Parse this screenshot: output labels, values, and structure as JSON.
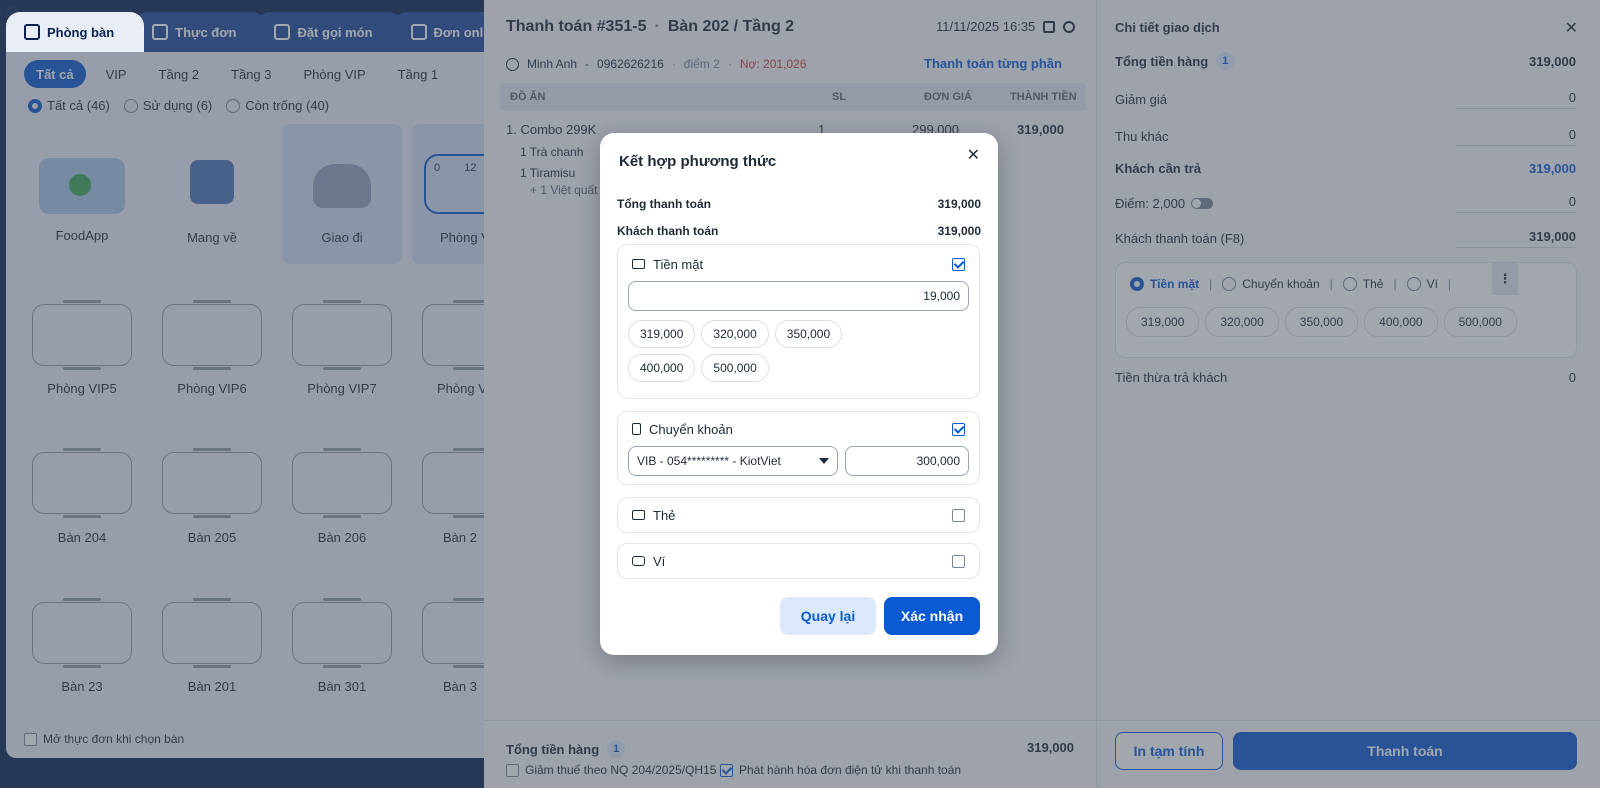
{
  "top_tabs": [
    "Phòng bàn",
    "Thực đơn",
    "Đặt gọi món",
    "Đơn online"
  ],
  "filters": [
    "Tất cả",
    "VIP",
    "Tầng 2",
    "Tầng 3",
    "Phòng VIP",
    "Tầng 1"
  ],
  "status_filters": [
    "Tất cả (46)",
    "Sử dụng (6)",
    "Còn trống (40)"
  ],
  "special_tiles": [
    "FoodApp",
    "Mang về",
    "Giao đi",
    "Phòng V"
  ],
  "occupied_tile": {
    "left": "0",
    "right": "12"
  },
  "rooms_row1": [
    "Phòng VIP5",
    "Phòng VIP6",
    "Phòng VIP7",
    "Phòng V"
  ],
  "rooms_row2": [
    "Bàn 204",
    "Bàn 205",
    "Bàn 206",
    "Bàn 2"
  ],
  "rooms_row3": [
    "Bàn 23",
    "Bàn 201",
    "Bàn 301",
    "Bàn 3"
  ],
  "open_menu_label": "Mở thực đơn khi chọn bàn",
  "order": {
    "title": "Thanh toán #351-5",
    "location": "Bàn 202 / Tầng 2",
    "datetime": "11/11/2025 16:35",
    "customer": "Minh Anh",
    "phone": "0962626216",
    "points": "điểm 2",
    "debt": "Nợ: 201,026",
    "split_link": "Thanh toán từng phần",
    "col_item": "ĐỒ ĂN",
    "col_qty": "SL",
    "col_price": "ĐƠN GIÁ",
    "col_total": "THÀNH TIỀN",
    "item_name": "1. Combo 299K",
    "item_qty": "1",
    "item_price": "299,000",
    "item_total": "319,000",
    "sub1": "1 Trà chanh",
    "sub2": "1 Tiramisu",
    "sub3": "+ 1 Việt quất",
    "footer_total_label": "Tổng tiền hàng",
    "footer_total_count": "1",
    "footer_total": "319,000",
    "tax_label": "Giảm thuế theo NQ 204/2025/QH15",
    "einvoice_label": "Phát hành hóa đơn điện tử khi thanh toán"
  },
  "modal": {
    "title": "Kết hợp phương thức",
    "total_label": "Tổng thanh toán",
    "total_value": "319,000",
    "paid_label": "Khách thanh toán",
    "paid_value": "319,000",
    "cash_label": "Tiền mặt",
    "cash_value": "19,000",
    "cash_amounts": [
      "319,000",
      "320,000",
      "350,000",
      "400,000",
      "500,000"
    ],
    "transfer_label": "Chuyển khoản",
    "bank_select": "VIB - 054********* - KiotViet",
    "transfer_value": "300,000",
    "card_label": "Thẻ",
    "wallet_label": "Ví",
    "back_button": "Quay lại",
    "confirm_button": "Xác nhận"
  },
  "detail": {
    "title": "Chi tiết giao dịch",
    "subtotal_label": "Tổng tiền hàng",
    "subtotal_count": "1",
    "subtotal_value": "319,000",
    "discount_label": "Giảm giá",
    "discount_value": "0",
    "other_label": "Thu khác",
    "other_value": "0",
    "due_label": "Khách cần trả",
    "due_value": "319,000",
    "points_label": "Điểm: 2,000",
    "points_value": "0",
    "paid_label": "Khách thanh toán (F8)",
    "paid_value": "319,000",
    "methods": [
      "Tiền mặt",
      "Chuyển khoản",
      "Thẻ",
      "Ví"
    ],
    "amounts": [
      "319,000",
      "320,000",
      "350,000",
      "400,000",
      "500,000"
    ],
    "change_label": "Tiền thừa trả khách",
    "change_value": "0",
    "print_button": "In tạm tính",
    "pay_button": "Thanh toán"
  },
  "colors": {
    "primary": "#0a5bd3",
    "navy": "#0a2352",
    "debt": "#d33a3a"
  }
}
